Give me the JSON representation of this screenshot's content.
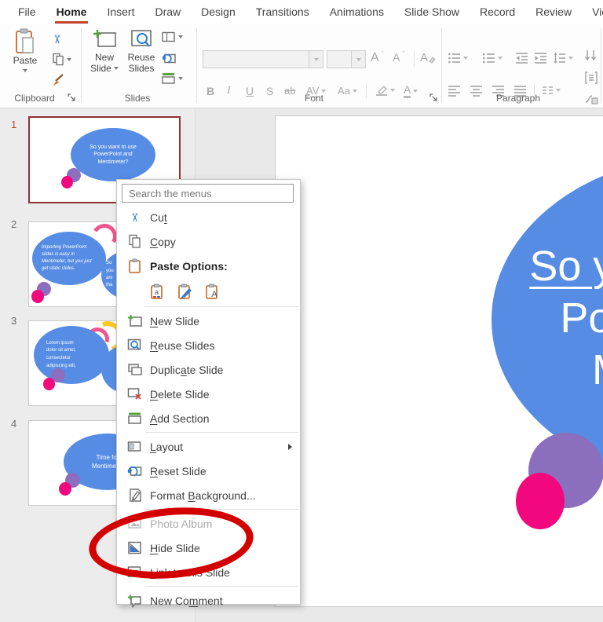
{
  "tabs": {
    "items": [
      "File",
      "Home",
      "Insert",
      "Draw",
      "Design",
      "Transitions",
      "Animations",
      "Slide Show",
      "Record",
      "Review",
      "View"
    ],
    "active": "Home"
  },
  "ribbon": {
    "paste_label": "Paste",
    "new_slide_1": "New",
    "new_slide_2": "Slide",
    "reuse_1": "Reuse",
    "reuse_2": "Slides",
    "group_clipboard": "Clipboard",
    "group_slides": "Slides",
    "group_font": "Font",
    "group_paragraph": "Paragraph",
    "bold": "B",
    "italic": "I",
    "underline": "U",
    "shadow": "S",
    "strike": "ab",
    "spacing": "AV",
    "case": "Aa",
    "font_color": "A",
    "grow": "A",
    "shrink": "A",
    "clear": "A"
  },
  "thumbnails": {
    "panel": [
      {
        "number": "1",
        "lines": [
          "So you want to use",
          "PowerPoint and",
          "Mentimeter?"
        ]
      },
      {
        "number": "2",
        "lines": [
          "Importing PowerPoint",
          "slides is easy in",
          "Mentimeter, but you just",
          "get static slides."
        ],
        "frag": [
          "So",
          "you",
          "ani",
          "tha"
        ]
      },
      {
        "number": "3",
        "lines": [
          "Lorem ipsum",
          "dolor sit amet,",
          "consectetur",
          "adipiscing elit,"
        ]
      },
      {
        "number": "4",
        "lines": [
          "Time for",
          "Mentimeter"
        ]
      }
    ]
  },
  "slide": {
    "lines": [
      "So you want to use",
      "PowerPoint and",
      "Mentimeter?"
    ]
  },
  "menu": {
    "search_placeholder": "Search the menus",
    "cut": {
      "pre": "Cu",
      "accel": "t",
      "post": ""
    },
    "copy": {
      "pre": "",
      "accel": "C",
      "post": "opy"
    },
    "paste_options": {
      "label": "Paste Options:"
    },
    "new_slide": {
      "pre": "",
      "accel": "N",
      "post": "ew Slide"
    },
    "reuse_slides": {
      "pre": "",
      "accel": "R",
      "post": "euse Slides"
    },
    "duplicate_slide": {
      "pre": "Duplic",
      "accel": "a",
      "post": "te Slide"
    },
    "delete_slide": {
      "pre": "",
      "accel": "D",
      "post": "elete Slide"
    },
    "add_section": {
      "pre": "",
      "accel": "A",
      "post": "dd Section"
    },
    "layout": {
      "pre": "",
      "accel": "L",
      "post": "ayout"
    },
    "reset_slide": {
      "pre": "",
      "accel": "R",
      "post": "eset Slide"
    },
    "format_background": {
      "pre": "Format ",
      "accel": "B",
      "post": "ackground..."
    },
    "photo_album": {
      "label": "Photo Album"
    },
    "hide_slide": {
      "pre": "",
      "accel": "H",
      "post": "ide Slide"
    },
    "link_to_slide": {
      "pre": "",
      "accel": "L",
      "post": "ink to this Slide"
    },
    "new_comment": {
      "pre": "New Co",
      "accel": "m",
      "post": "ment"
    }
  },
  "colors": {
    "active_tab_underline": "#C3432E",
    "annotation_red": "#D30000",
    "bubble_blue": "#568CE3",
    "purple": "#8B6FBE",
    "pink": "#F2077E",
    "arc_yellow": "#FFC81E",
    "arc_pink": "#F2548C",
    "selected_thumb_border": "#8F3136"
  }
}
